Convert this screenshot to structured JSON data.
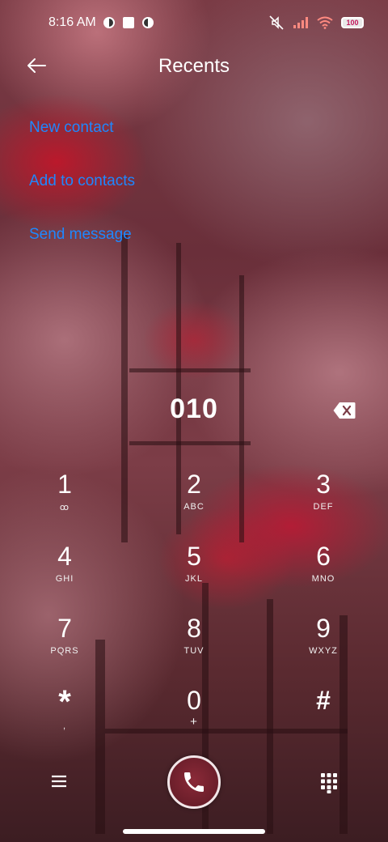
{
  "status_bar": {
    "time": "8:16 AM",
    "battery_level": "100",
    "icons": [
      "app-notification-icon",
      "square-notification-icon",
      "app-notification-icon",
      "mute-icon",
      "signal-icon",
      "wifi-icon",
      "battery-icon"
    ]
  },
  "header": {
    "title": "Recents",
    "back_icon": "arrow-left-icon"
  },
  "actions": [
    {
      "label": "New contact"
    },
    {
      "label": "Add to contacts"
    },
    {
      "label": "Send message"
    }
  ],
  "dial": {
    "number": "010",
    "backspace_icon": "backspace-icon"
  },
  "keypad": [
    {
      "digit": "1",
      "letters": "ꝏ"
    },
    {
      "digit": "2",
      "letters": "ABC"
    },
    {
      "digit": "3",
      "letters": "DEF"
    },
    {
      "digit": "4",
      "letters": "GHI"
    },
    {
      "digit": "5",
      "letters": "JKL"
    },
    {
      "digit": "6",
      "letters": "MNO"
    },
    {
      "digit": "7",
      "letters": "PQRS"
    },
    {
      "digit": "8",
      "letters": "TUV"
    },
    {
      "digit": "9",
      "letters": "WXYZ"
    },
    {
      "digit": "*",
      "letters": ","
    },
    {
      "digit": "0",
      "letters": "+"
    },
    {
      "digit": "#",
      "letters": ""
    }
  ],
  "bottom": {
    "menu_icon": "menu-icon",
    "call_icon": "phone-icon",
    "dialpad_icon": "dialpad-icon"
  },
  "colors": {
    "link": "#1e88ff",
    "call_button": "#6b1e2a"
  }
}
